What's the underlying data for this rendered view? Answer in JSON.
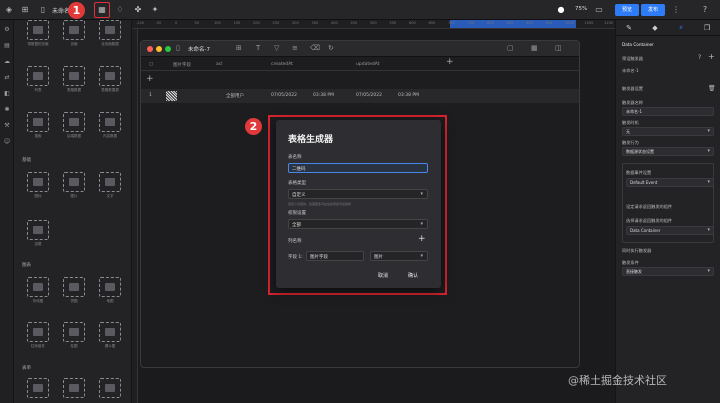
{
  "topbar": {
    "doc_title": "未命名-7",
    "zoom": "75%",
    "preview": "预览",
    "publish": "发布",
    "badge1": "1",
    "badge2": "2"
  },
  "panel": {
    "row1": [
      "带数据的页面",
      "页面",
      "全页面数据"
    ],
    "row2": [
      "列表",
      "表格数据",
      "表格数据源"
    ],
    "row3": [
      "搜索",
      "后端数据",
      "内容数据"
    ],
    "sec_basic": "基础",
    "row4": [
      "图标",
      "图片",
      "文字"
    ],
    "row5": [
      "加载"
    ],
    "sec_chart": "图表",
    "row6": [
      "折线图",
      "饼图",
      "地图"
    ],
    "row7": [
      "柱状组件",
      "柱图",
      "漏斗图"
    ],
    "sec_form": "表单"
  },
  "ruler_ticks": [
    "-100",
    "-50",
    "0",
    "50",
    "100",
    "150",
    "200",
    "250",
    "300",
    "350",
    "400",
    "450",
    "500",
    "550",
    "600",
    "650",
    "700",
    "750",
    "800",
    "850",
    "900",
    "950",
    "1000",
    "1050",
    "1100"
  ],
  "window": {
    "title": "未命名-7",
    "headers": [
      "图片字段",
      "acl",
      "createdAt",
      "updatedAt"
    ],
    "row": {
      "num": "1",
      "acl": "全部用户",
      "c_date": "07/05/2022",
      "c_time": "03:38 PM",
      "u_date": "07/05/2022",
      "u_time": "03:38 PM"
    }
  },
  "modal": {
    "title": "表格生成器",
    "name_label": "表名称",
    "name_value": "二维码",
    "type_label": "表格类型",
    "type_value": "自定义",
    "type_hint": "自定义表结构，如需更多可在后续添加字段编辑",
    "perm_label": "权限设置",
    "perm_value": "全部",
    "cols_label": "列名称",
    "field_label": "字段 1:",
    "field_name": "图片字段",
    "field_type": "图片",
    "cancel": "取消",
    "confirm": "确认"
  },
  "right": {
    "component": "Data Container",
    "group": "预设触发器",
    "name": "未命名-1",
    "section_trigger": "触发器设置",
    "trigger_name_label": "触发器名称",
    "trigger_name_value": "未命名-1",
    "trigger_time_label": "触发时机",
    "trigger_time_value": "无",
    "trigger_action_label": "触发行为",
    "trigger_action_value": "数据源状态设置",
    "sub1_label": "数据事件设置",
    "sub1_value": "Default Event",
    "sub2_label": "设定请求返回触发的组件",
    "sub3_label": "选择请求返回触发的组件",
    "sub3_value": "Data Container",
    "sub4_label": "同时执行触发器",
    "sub5_label": "触发条件",
    "sub5_value": "直接触发"
  },
  "watermark": "@稀土掘金技术社区"
}
